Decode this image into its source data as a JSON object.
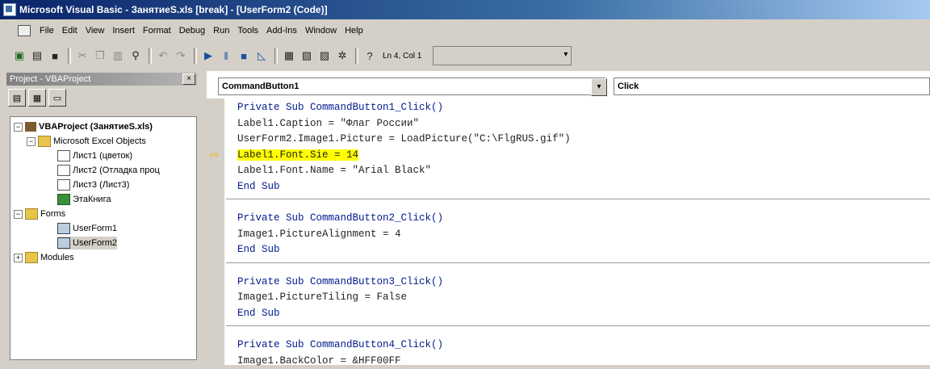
{
  "window": {
    "title": "Microsoft Visual Basic - ЗанятиеS.xls [break] - [UserForm2 (Code)]"
  },
  "menu": [
    "File",
    "Edit",
    "View",
    "Insert",
    "Format",
    "Debug",
    "Run",
    "Tools",
    "Add-Ins",
    "Window",
    "Help"
  ],
  "toolbar": {
    "cursor_position": "Ln 4, Col 1"
  },
  "project": {
    "title": "Project - VBAProject",
    "close": "×",
    "tree": {
      "root": "VBAProject (ЗанятиеS.xls)",
      "excel_objects": "Microsoft Excel Objects",
      "sheets": [
        "Лист1 (цветок)",
        "Лист2 (Отладка проц",
        "Лист3 (Лист3)"
      ],
      "workbook": "ЭтаКнига",
      "forms": "Forms",
      "form_items": [
        "UserForm1",
        "UserForm2"
      ],
      "modules": "Modules"
    }
  },
  "code": {
    "object_combo": "CommandButton1",
    "proc_combo": "Click",
    "lines": {
      "p1_sig": "Private Sub CommandButton1_Click()",
      "p1_l1": "Label1.Caption = \"Флаг России\"",
      "p1_l2": "UserForm2.Image1.Picture = LoadPicture(\"C:\\FlgRUS.gif\")",
      "p1_l3": "Label1.Font.Sie = 14",
      "p1_l4": "Label1.Font.Name = \"Arial Black\"",
      "p1_end": "End Sub",
      "p2_sig": "Private Sub CommandButton2_Click()",
      "p2_l1": "Image1.PictureAlignment = 4",
      "p2_end": "End Sub",
      "p3_sig": "Private Sub CommandButton3_Click()",
      "p3_l1": "Image1.PictureTiling = False",
      "p3_end": "End Sub",
      "p4_sig": "Private Sub CommandButton4_Click()",
      "p4_l1": "Image1.BackColor = &HFF00FF"
    }
  }
}
